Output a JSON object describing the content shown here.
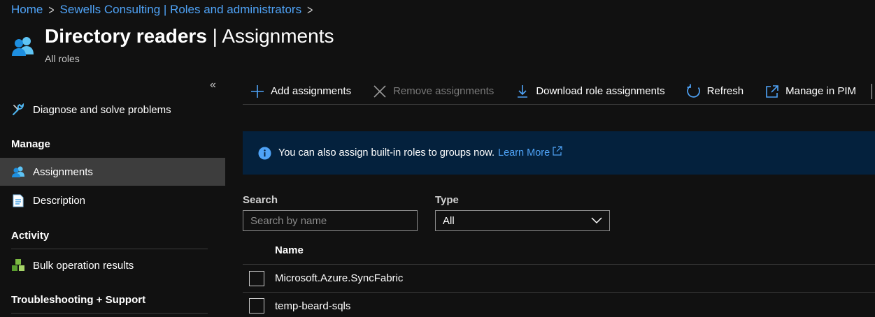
{
  "breadcrumb": {
    "items": [
      "Home",
      "Sewells Consulting | Roles and administrators"
    ]
  },
  "header": {
    "title_bold": "Directory readers",
    "title_rest": " | Assignments",
    "subtitle": "All roles"
  },
  "sidebar": {
    "collapse_glyph": "«",
    "diagnose_label": "Diagnose and solve problems",
    "manage_heading": "Manage",
    "assignments_label": "Assignments",
    "description_label": "Description",
    "activity_heading": "Activity",
    "bulk_label": "Bulk operation results",
    "troubleshooting_heading": "Troubleshooting + Support"
  },
  "toolbar": {
    "add_label": "Add assignments",
    "remove_label": "Remove assignments",
    "download_label": "Download role assignments",
    "refresh_label": "Refresh",
    "pim_label": "Manage in PIM"
  },
  "banner": {
    "text": "You can also assign built-in roles to groups now.",
    "link": "Learn More"
  },
  "filters": {
    "search_label": "Search",
    "search_placeholder": "Search by name",
    "type_label": "Type",
    "type_value": "All"
  },
  "table": {
    "name_header": "Name",
    "rows": [
      {
        "name": "Microsoft.Azure.SyncFabric"
      },
      {
        "name": "temp-beard-sqls"
      }
    ]
  },
  "colors": {
    "background": "#111111",
    "link": "#4fa3f7",
    "banner_bg": "#04213d",
    "active_nav": "#3d3d3d",
    "disabled_text": "#7a7a7a"
  },
  "icons": {
    "header": "users-icon",
    "diagnose": "wrench-icon",
    "assignments": "users-icon",
    "description": "document-icon",
    "bulk": "cubes-icon",
    "add": "plus-icon",
    "remove": "x-icon",
    "download": "download-icon",
    "refresh": "refresh-icon",
    "pim": "external-link-icon",
    "info": "info-icon",
    "dropdown": "chevron-down-icon"
  }
}
